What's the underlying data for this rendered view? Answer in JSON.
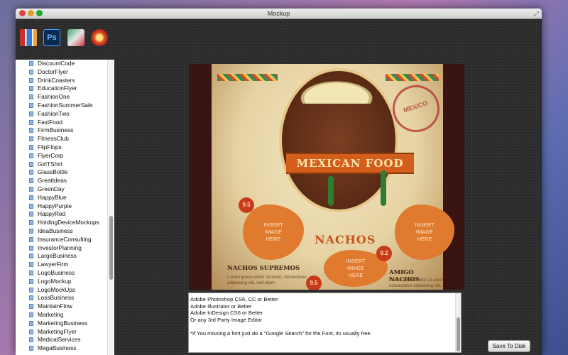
{
  "window": {
    "title": "Mockup"
  },
  "sidebar": {
    "items": [
      "DiscountCode",
      "DoctorFlyer",
      "DrinkCoasters",
      "EducationFlyer",
      "FashionOne",
      "FashionSummerSale",
      "FashionTwo",
      "FastFood",
      "FirmBusiness",
      "FitnessClub",
      "FlipFlops",
      "FlyerCorp",
      "GirlTShirt",
      "GlassBottle",
      "GreatIdeas",
      "GreenDay",
      "HappyBlue",
      "HappyPurple",
      "HappyRed",
      "HoldingDeviceMockups",
      "IdeaBusiness",
      "InsuranceConsulting",
      "InvestorPlanning",
      "LargeBusiness",
      "LawyerFirm",
      "LogoBusiness",
      "LogoMockup",
      "LogoMockUps",
      "LossBusiness",
      "MaintainFlow",
      "Marketing",
      "MarketingBusiness",
      "MarketingFlyer",
      "MedicalServices",
      "MegaBusiness"
    ]
  },
  "toolbar": {
    "icons": [
      "pages-icon",
      "photoshop-icon",
      "cards-icon",
      "illustrator-icon"
    ],
    "photoshop_glyph": "Ps"
  },
  "preview": {
    "stamp_text": "MEXICO",
    "banner_text": "MEXICAN FOOD",
    "nachos_title": "NACHOS",
    "prices": [
      "9.5",
      "9.5",
      "9.2"
    ],
    "insert_image": "INSERT\nIMAGE\nHERE",
    "left_heading": "NACHOS SUPREMOS",
    "left_desc": "Lorem ipsum dolor sit amet, consectetur adipiscing elit, sed diam",
    "right_heading": "AMIGO NACHOS",
    "right_desc": "Lorem ipsum dolor sit amet, consectetur adipiscing elit,"
  },
  "info": {
    "lines": [
      "Adobe Photoshop CS6, CC or Better",
      "Adobe Illustrator or Better",
      "Adobe InDesign CS6 or Better",
      "Or any 3rd Party Image Editor"
    ],
    "note": "*If You missing a font just do a \"Google Search\" for the Font, its usually free."
  },
  "actions": {
    "save_label": "Save To Disk"
  }
}
